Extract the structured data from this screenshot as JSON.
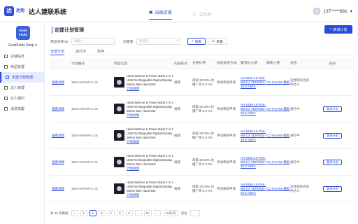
{
  "app": {
    "logo_mark": "达",
    "logo_sub": "达到",
    "title": "达人建联系统"
  },
  "toptabs": [
    {
      "label": "自助店铺"
    },
    {
      "label": "工作台"
    }
  ],
  "user": {
    "phone": "137*****881"
  },
  "shop": {
    "logo_text": "Good Finds",
    "name": "GoodFinds Shop"
  },
  "nav": [
    {
      "label": "店铺信息"
    },
    {
      "label": "商品管理"
    },
    {
      "label": "定建计划管理"
    },
    {
      "label": "达人管理"
    },
    {
      "label": "达人邀约"
    },
    {
      "label": "消息提醒"
    }
  ],
  "page": {
    "title": "定建计划管理",
    "add_button": "新增计划"
  },
  "filters": {
    "product_label": "商品名称/ID:",
    "product_placeholder": "请输入",
    "date_label": "创建者:",
    "date_placeholder": "请选择",
    "search_button": "搜索",
    "reset_button": "重置"
  },
  "subtabs": [
    {
      "label": "全部计划"
    },
    {
      "label": "进行中"
    },
    {
      "label": "暂停"
    }
  ],
  "table": {
    "headers": [
      "",
      "计划编号",
      "商品信息",
      "内容形式",
      "分佣比例",
      "样品发货方式",
      "置顶达人链",
      "群聊入链",
      "状态",
      "操作"
    ],
    "rows": [
      {
        "detail": "查看详情",
        "plan_id": "1015-HV/HW-C-16",
        "product": "Hand Warmer & Power Bank 2 in 1 USB Rechargeable Digital Display Winter Mini Hand War",
        "product_link": "计划详情",
        "content": "视频",
        "commission": "商家:20.00% 达播厂商:5.0 0%",
        "shipping": "手动审核申请",
        "top_link": "AH-5190-1K-P5K-9M-CA TEHP334-28 E-V5FA",
        "group_link": "CC-HV/HW 模板",
        "status": "没找到符合条件达人",
        "op": ""
      },
      {
        "detail": "查看详情",
        "plan_id": "1015-HV/HW-C-16",
        "product": "Hand Warmer & Power Bank 2 in 1 USB Rechargeable Digital Display Winter Mini Hand War",
        "product_link": "计划详情",
        "content": "视频",
        "commission": "商家:20.00% 达播厂商:5.0 0%",
        "shipping": "手动审核申请",
        "top_link": "AH-5190-1K-P5K-9M-CA TEHP334-28 E-V5FA",
        "group_link": "CC-HV/HW 模板",
        "status": "进行中",
        "op": "暂停计划"
      },
      {
        "detail": "查看详情",
        "plan_id": "1015-HV/HW-C-16",
        "product": "Hand Warmer & Power Bank 2 in 1 USB Rechargeable Digital Display Winter Mini Hand War",
        "product_link": "计划详情",
        "content": "视频",
        "commission": "商家:20.00% 达播厂商:5.0 0%",
        "shipping": "手动审核申请",
        "top_link": "AH-5190-1K-P5K-9M-CA TEHP334-28 E-V5FA",
        "group_link": "CC-HV/HW 模板",
        "status": "进行中",
        "op": "暂停计划"
      },
      {
        "detail": "查看详情",
        "plan_id": "1015-HV/HW-C-16",
        "product": "Hand Warmer & Power Bank 2 in 1 USB Rechargeable Digital Display Winter Mini Hand War",
        "product_link": "计划详情",
        "content": "视频",
        "commission": "商家:20.00% 达播厂商:5.0 0%",
        "shipping": "手动审核申请",
        "top_link": "AH-5190-1K-P5K-9M-CA TEHP334-28 E-V5FA",
        "group_link": "CC-HV/HW 模板",
        "status": "进行中",
        "op": "暂停计划"
      },
      {
        "detail": "查看详情",
        "plan_id": "1015-HV/HW-C-16",
        "product": "Hand Warmer & Power Bank 2 in 1 USB Rechargeable Digital Display Winter Mini Hand War",
        "product_link": "计划详情",
        "content": "视频",
        "commission": "商家:20.00% 达播厂商:5.0 0%",
        "shipping": "手动审核申请",
        "top_link": "AH-5190-1K-P5K-9M-CA TEHP334-28 E-V5FA",
        "group_link": "CC-HV/HW 模板",
        "status": "没找到符合条件达人",
        "op": "暂停计划"
      }
    ]
  },
  "pager": {
    "total": "共 35 条数据",
    "pages": [
      "‹",
      "1",
      "2",
      "3",
      "4",
      "5",
      "6",
      "...",
      "10",
      "›"
    ],
    "active": "2",
    "size": "10条/页",
    "goto": "前往"
  },
  "colors": {
    "accent": "#2a4bd7"
  }
}
